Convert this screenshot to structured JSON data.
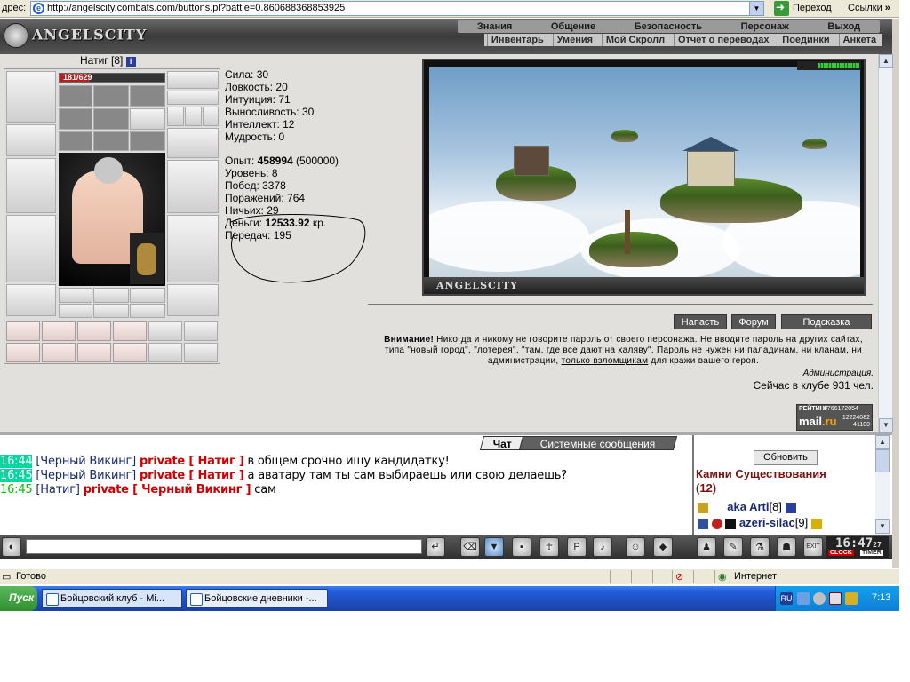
{
  "addressbar": {
    "label": "дрес:",
    "url": "http://angelscity.combats.com/buttons.pl?battle=0.860688368853925",
    "go": "Переход",
    "links": "Ссылки"
  },
  "banner": {
    "logo": "ANGELSCITY",
    "menu_top": [
      "Знания",
      "Общение",
      "Безопасность",
      "Персонаж",
      "Выход"
    ],
    "menu_sub": [
      "Инвентарь",
      "Умения",
      "Мой Скролл",
      "Отчет о переводах",
      "Поединки",
      "Анкета"
    ]
  },
  "character": {
    "name": "Натиг",
    "level": "[8]",
    "info_icon": "i",
    "hp": "181/629",
    "hp_fraction": 0.288
  },
  "stats": {
    "attrs": [
      "Сила: 30",
      "Ловкость: 20",
      "Интуиция: 71",
      "Выносливость: 30",
      "Интеллект: 12",
      "Мудрость: 0"
    ],
    "exp_label": "Опыт: ",
    "exp_value": "458994",
    "exp_next": " (500000)",
    "level": "Уровень: 8",
    "wins": "Побед: 3378",
    "losses": "Поражений: 764",
    "draws": "Ничьих: 29",
    "money_label": "Деньги: ",
    "money_value": "12533.92",
    "money_unit": " кр.",
    "transfers": "Передач: 195"
  },
  "scene": {
    "caption": "ANGELSCITY"
  },
  "actions": {
    "attack": "Напасть",
    "forum": "Форум",
    "hint": "Подсказка"
  },
  "warning": {
    "bold": "Внимание!",
    "text1": " Никогда и никому не говорите пароль от своего персонажа. Не вводите пароль на других сайтах, типа \"новый город\", \"лотерея\", \"там, где все дают на халяву\". Пароль не нужен ни паладинам, ни кланам, ни администрации, ",
    "underline": "только взломщикам",
    "text2": " для кражи вашего героя.",
    "signature": "Администрация."
  },
  "online": "Сейчас в клубе 931 чел.",
  "rating": {
    "title": "РЕЙТИНГ",
    "n1": "8766172054",
    "logo1": "mail",
    "logo2": ".ru",
    "n2": "12224082",
    "n3": "41100"
  },
  "chat": {
    "tab_chat": "Чат",
    "tab_system": "Системные сообщения",
    "messages": [
      {
        "time": "16:44",
        "from": "[Черный Викинг]",
        "private": "private [ Натиг ]",
        "text": " в общем срочно ищу кандидатку!"
      },
      {
        "time": "16:45",
        "from": "[Черный Викинг]",
        "private": "private [ Натиг ]",
        "text": " а аватару там ты сам выбираешь или свою делаешь?"
      },
      {
        "time": "16:45",
        "from": "[Натиг]",
        "private": "private [ Черный Викинг ]",
        "text": " сам"
      }
    ]
  },
  "room": {
    "refresh": "Обновить",
    "name": "Камни Существования",
    "count": "(12)",
    "users": [
      {
        "nick": "aka Arti",
        "level": "[8]"
      },
      {
        "nick": "azeri-silac",
        "level": "[9]"
      }
    ]
  },
  "toolbar": {
    "clock_time": "16:47",
    "clock_sec": "27",
    "clock_label": "CLOCK",
    "timer_label": "TIMER",
    "exit": "EXIT"
  },
  "statusbar": {
    "ready": "Готово",
    "zone": "Интернет"
  },
  "taskbar": {
    "start": "Пуск",
    "tasks": [
      "Бойцовский клуб - Mi...",
      "Бойцовские дневники -..."
    ],
    "lang": "RU",
    "time": "7:13"
  }
}
